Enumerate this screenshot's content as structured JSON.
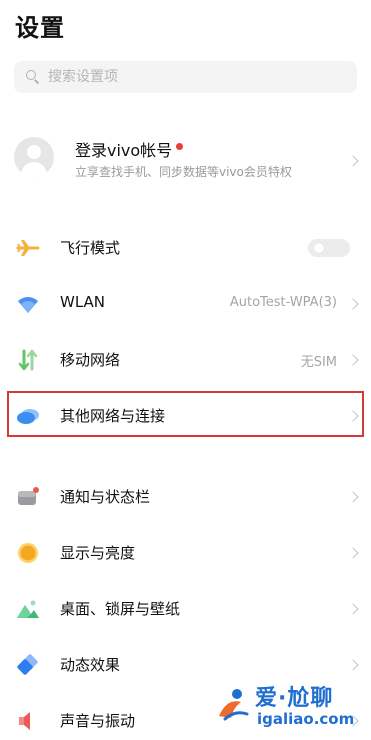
{
  "header": {
    "title": "设置"
  },
  "search": {
    "placeholder": "搜索设置项"
  },
  "account": {
    "title": "登录vivo帐号",
    "subtitle": "立享查找手机、同步数据等vivo会员特权"
  },
  "group1": [
    {
      "label": "飞行模式",
      "icon": "airplane-icon",
      "toggle": false
    },
    {
      "label": "WLAN",
      "icon": "wifi-icon",
      "value": "AutoTest-WPA(3)"
    },
    {
      "label": "移动网络",
      "icon": "mobile-data-icon",
      "value": "无SIM"
    },
    {
      "label": "其他网络与连接",
      "icon": "other-networks-icon"
    }
  ],
  "group2": [
    {
      "label": "通知与状态栏",
      "icon": "notification-icon"
    },
    {
      "label": "显示与亮度",
      "icon": "brightness-icon"
    },
    {
      "label": "桌面、锁屏与壁纸",
      "icon": "wallpaper-icon"
    },
    {
      "label": "动态效果",
      "icon": "animation-icon"
    },
    {
      "label": "声音与振动",
      "icon": "sound-icon"
    }
  ],
  "watermark": {
    "cn": "爱·尬聊",
    "url": "igaliao.com"
  },
  "colors": {
    "highlight": "#d43a3a",
    "accent_blue": "#3a8ef0",
    "notification_dot": "#ea3a3a"
  }
}
